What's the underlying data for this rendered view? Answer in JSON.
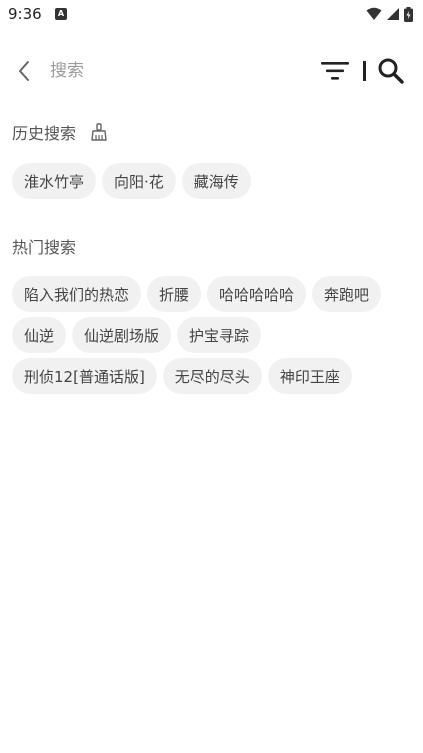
{
  "status_bar": {
    "time": "9:36",
    "app_icon_letter": "A"
  },
  "search": {
    "placeholder": "搜索",
    "value": ""
  },
  "history": {
    "title": "历史搜索",
    "items": [
      "淮水竹亭",
      "向阳·花",
      "藏海传"
    ]
  },
  "hot": {
    "title": "热门搜索",
    "rows": [
      [
        "陷入我们的热恋",
        "折腰",
        "哈哈哈哈哈",
        "奔跑吧"
      ],
      [
        "仙逆",
        "仙逆剧场版",
        "护宝寻踪"
      ],
      [
        "刑侦12[普通话版]",
        "无尽的尽头",
        "神印王座"
      ]
    ]
  },
  "icons": {
    "back": "chevron-left-icon",
    "filter": "filter-icon",
    "search": "search-icon",
    "clear": "broom-icon"
  }
}
